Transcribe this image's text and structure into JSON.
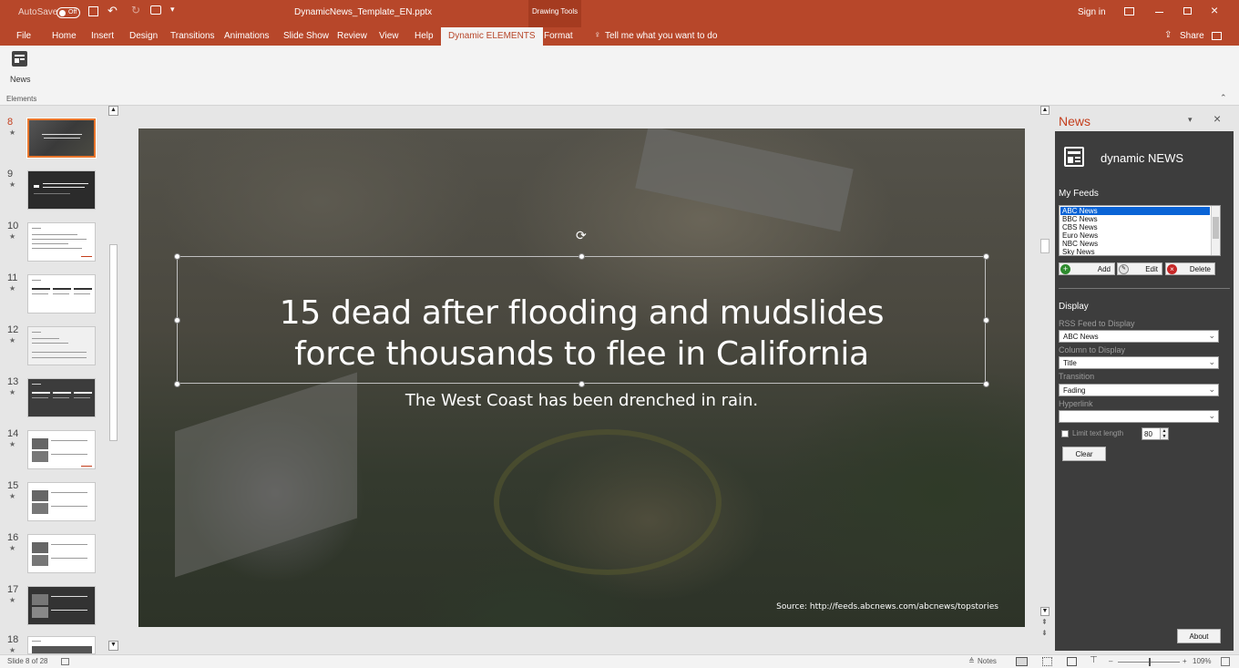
{
  "titlebar": {
    "autosave_label": "AutoSave",
    "autosave_state": "Off",
    "filename": "DynamicNews_Template_EN.pptx",
    "context": "Drawing Tools",
    "sign_in": "Sign in"
  },
  "tabs": [
    "File",
    "Home",
    "Insert",
    "Design",
    "Transitions",
    "Animations",
    "Slide Show",
    "Review",
    "View",
    "Help",
    "Dynamic ELEMENTS",
    "Format"
  ],
  "tell_me": "Tell me what you want to do",
  "share": "Share",
  "ribbon": {
    "news_button": "News",
    "group_label": "Elements"
  },
  "thumbnails": {
    "numbers": [
      "8",
      "9",
      "10",
      "11",
      "12",
      "13",
      "14",
      "15",
      "16",
      "17",
      "18"
    ],
    "star": "★"
  },
  "slide": {
    "headline_line1": "15 dead after flooding and mudslides",
    "headline_line2": "force thousands to flee in California",
    "subtitle": "The West Coast has been drenched in rain.",
    "source": "Source: http://feeds.abcnews.com/abcnews/topstories"
  },
  "panel": {
    "title": "News",
    "brand": "dynamic NEWS",
    "my_feeds": "My Feeds",
    "feeds": [
      "ABC News",
      "BBC News",
      "CBS News",
      "Euro News",
      "NBC News",
      "Sky News"
    ],
    "add": "Add",
    "edit": "Edit",
    "delete": "Delete",
    "display": "Display",
    "rss_label": "RSS Feed to Display",
    "rss_value": "ABC News",
    "column_label": "Column to Display",
    "column_value": "Title",
    "transition_label": "Transition",
    "transition_value": "Fading",
    "hyperlink_label": "Hyperlink",
    "hyperlink_value": "",
    "limit_label": "Limit text length",
    "limit_value": "80",
    "clear": "Clear",
    "about": "About"
  },
  "status": {
    "slide_info": "Slide 8 of 28",
    "notes": "Notes",
    "zoom": "109%"
  },
  "colors": {
    "accent": "#b7472a",
    "selected_thumb": "#e8762d",
    "panel_bg": "#3d3d3d"
  }
}
